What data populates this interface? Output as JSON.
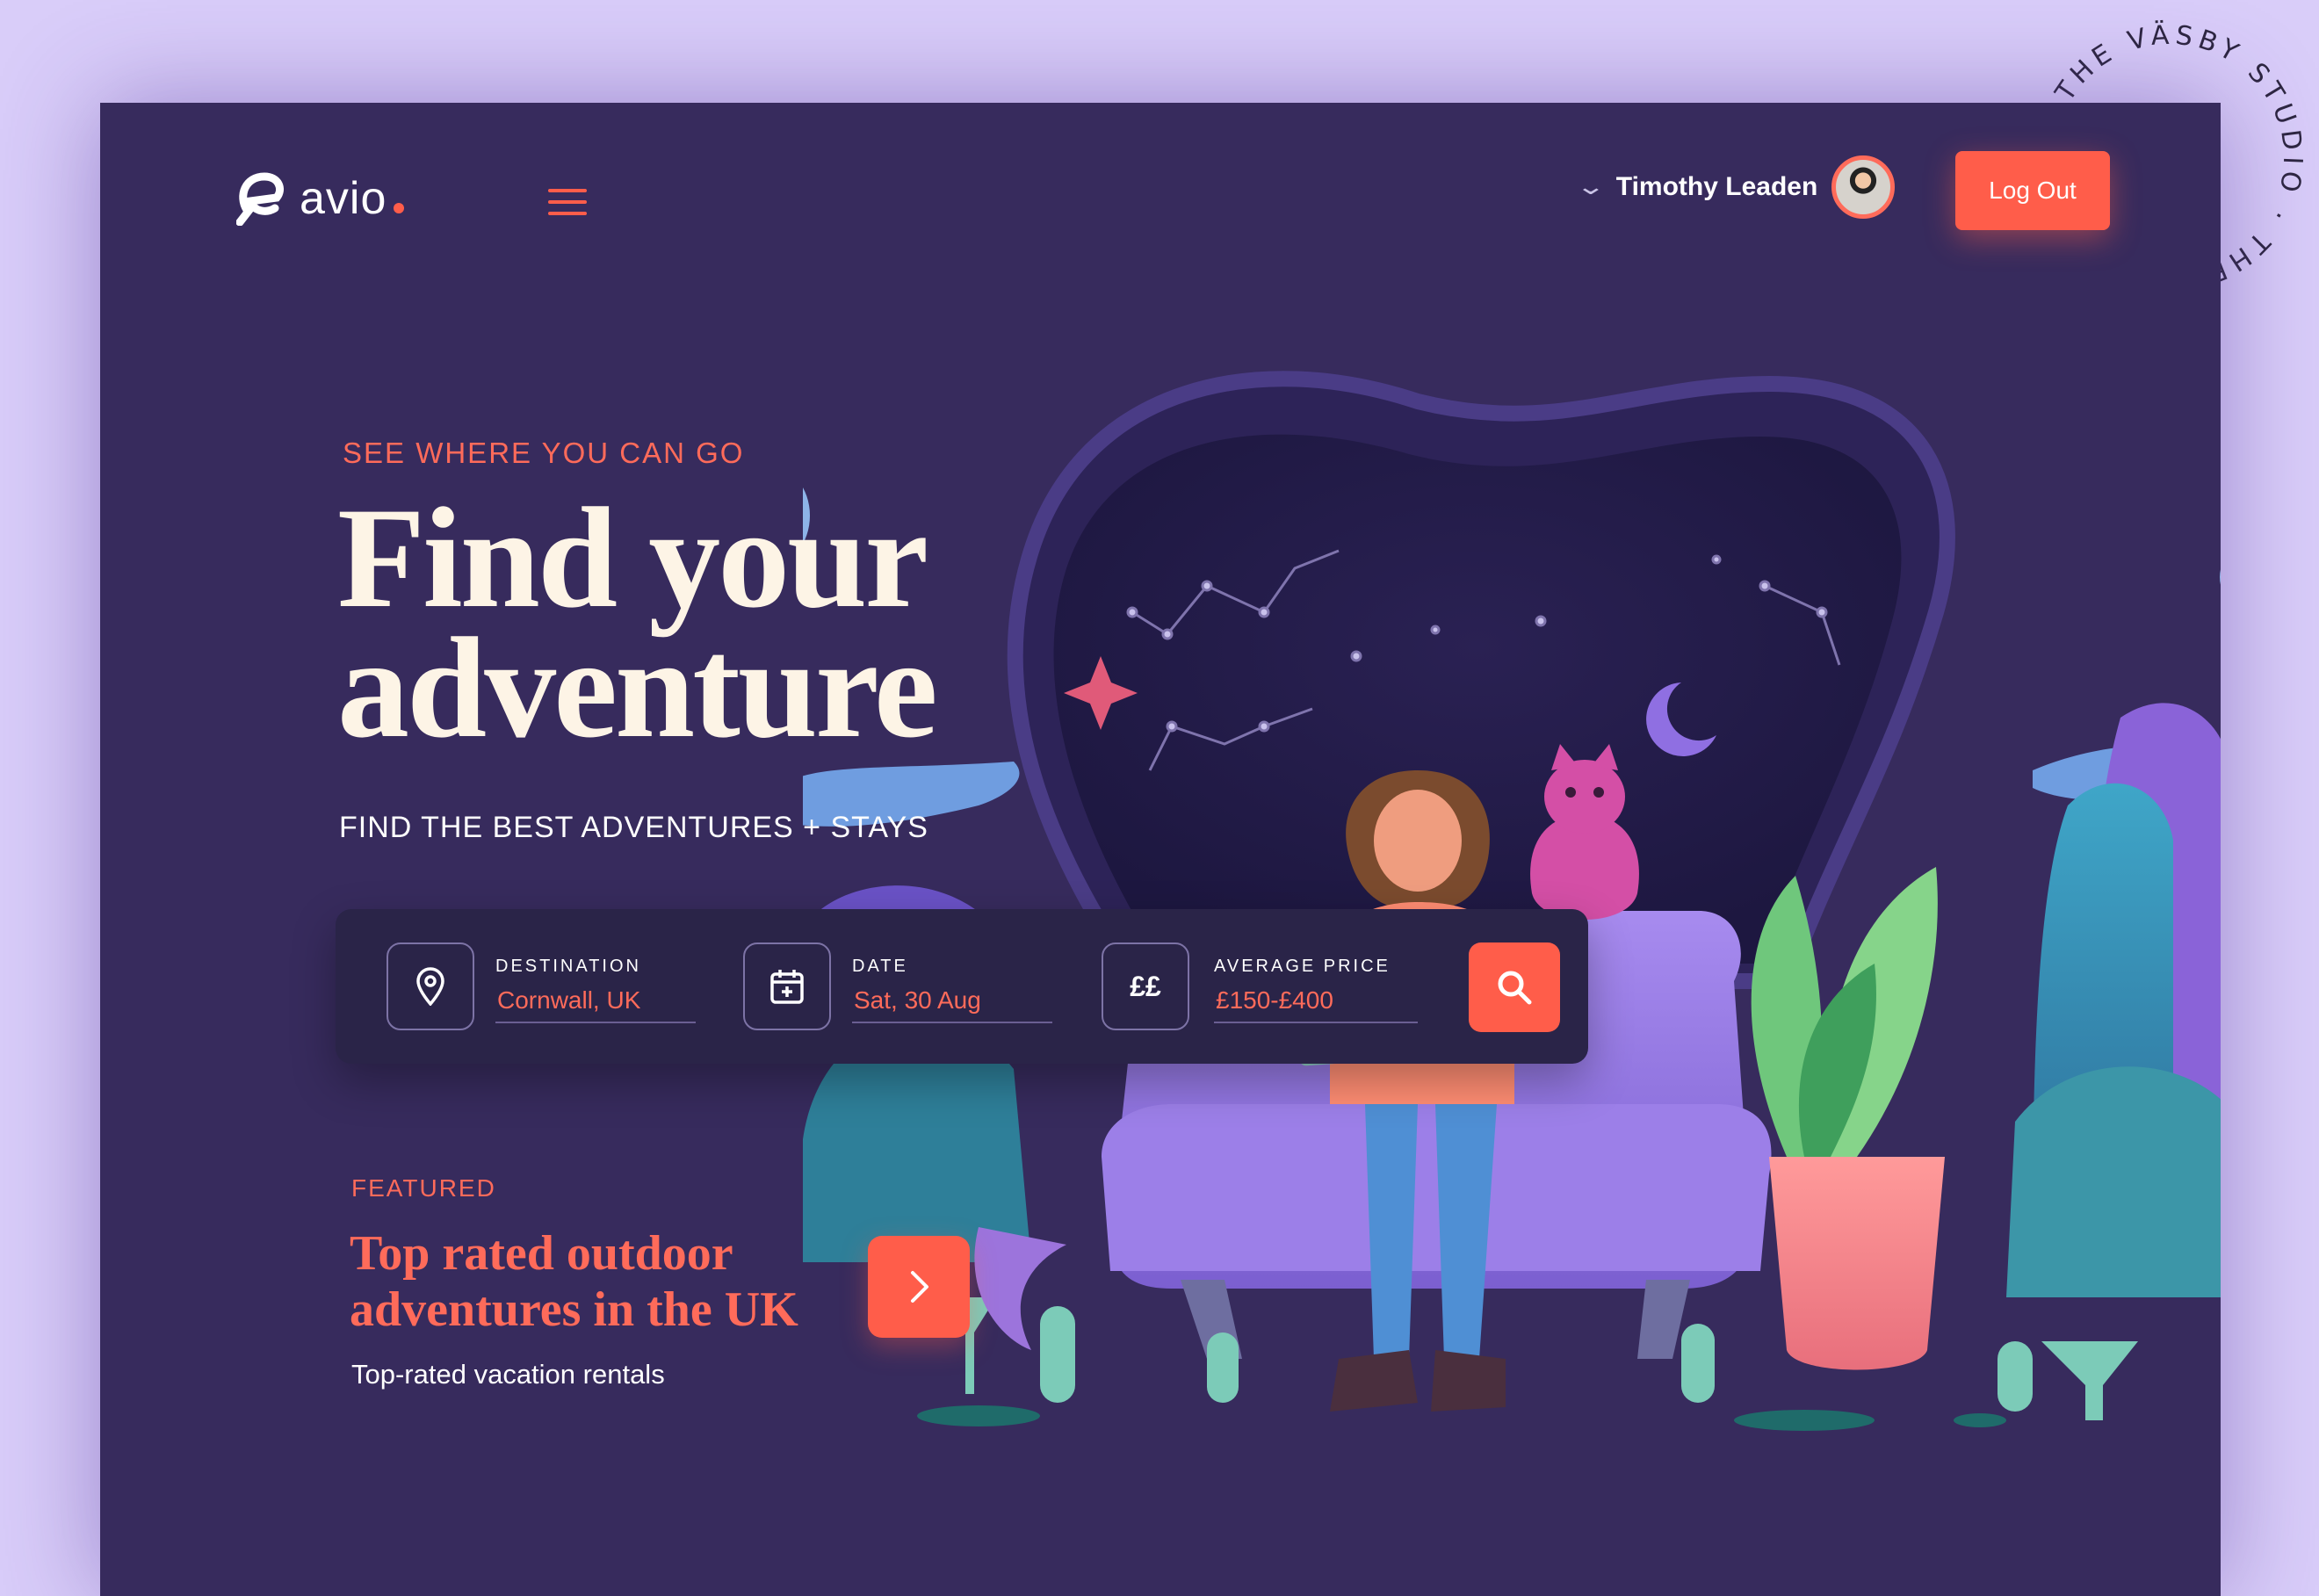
{
  "badge": {
    "text": "THE VÄSBY STUDIO · THE VÄSBY STUDIO ·"
  },
  "brand": {
    "name": "avio"
  },
  "header": {
    "user_name": "Timothy Leaden",
    "logout_label": "Log Out"
  },
  "hero": {
    "eyebrow": "SEE WHERE YOU CAN GO",
    "headline": "Find your\nadventure",
    "subhead": "FIND THE BEST ADVENTURES + STAYS"
  },
  "search": {
    "destination": {
      "label": "DESTINATION",
      "value": "Cornwall, UK",
      "icon": "location-pin-icon"
    },
    "date": {
      "label": "DATE",
      "value": "Sat, 30 Aug",
      "icon": "calendar-add-icon"
    },
    "price": {
      "label": "AVERAGE PRICE",
      "value": "£150-£400",
      "icon_text": "££"
    }
  },
  "featured": {
    "eyebrow": "FEATURED",
    "title": "Top rated outdoor adventures in the UK",
    "subtitle": "Top-rated vacation rentals"
  },
  "colors": {
    "accent": "#ff5d4a",
    "panel": "#372b5d",
    "page_bg": "#d9cdf9",
    "headline": "#fdf4e6"
  }
}
